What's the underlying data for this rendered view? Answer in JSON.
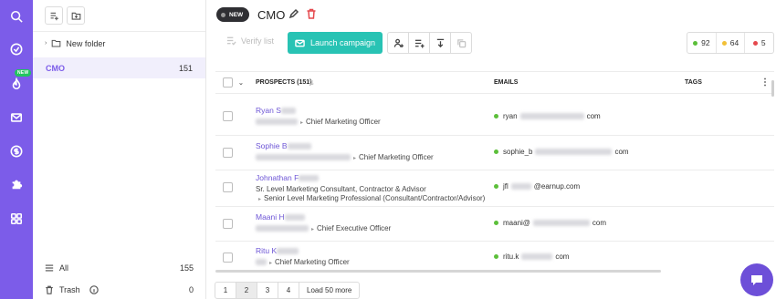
{
  "rail": {
    "new_badge": "NEW"
  },
  "sidebar": {
    "folder_label": "New folder",
    "active_list": {
      "name": "CMO",
      "count": "151"
    },
    "all": {
      "label": "All",
      "count": "155"
    },
    "trash": {
      "label": "Trash",
      "count": "0"
    }
  },
  "header": {
    "badge": "NEW",
    "title": "CMO"
  },
  "toolbar": {
    "verify_label": "Verify list",
    "launch_label": "Launch campaign"
  },
  "stats": {
    "green": "92",
    "yellow": "64",
    "red": "5",
    "colors": {
      "green": "#5cbf3a",
      "yellow": "#f2c037",
      "red": "#e5484d"
    }
  },
  "table": {
    "columns": {
      "prospects": "PROSPECTS (151)",
      "emails": "EMAILS",
      "tags": "TAGS"
    },
    "rows": [
      {
        "name": "Ryan S",
        "line1": "Chief Marketing Officer",
        "line2": "",
        "email_start": "ryan",
        "email_end": "com"
      },
      {
        "name": "Sophie B",
        "line1": "Chief Marketing Officer",
        "line2": "",
        "email_start": "sophie_b",
        "email_end": "com"
      },
      {
        "name": "Johnathan F",
        "line1": "Sr. Level Marketing Consultant, Contractor & Advisor",
        "line2": "Senior Level Marketing Professional (Consultant/Contractor/Advisor)",
        "email_start": "jfl",
        "email_end": "@earnup.com"
      },
      {
        "name": "Maani H",
        "line1": "Chief Executive Officer",
        "line2": "",
        "email_start": "maani@",
        "email_end": "com"
      },
      {
        "name": "Ritu K",
        "line1": "Chief Marketing Officer",
        "line2": "",
        "email_start": "ritu.k",
        "email_end": "com"
      }
    ]
  },
  "pager": {
    "p1": "1",
    "p2": "2",
    "p3": "3",
    "p4": "4",
    "more": "Load 50 more"
  }
}
